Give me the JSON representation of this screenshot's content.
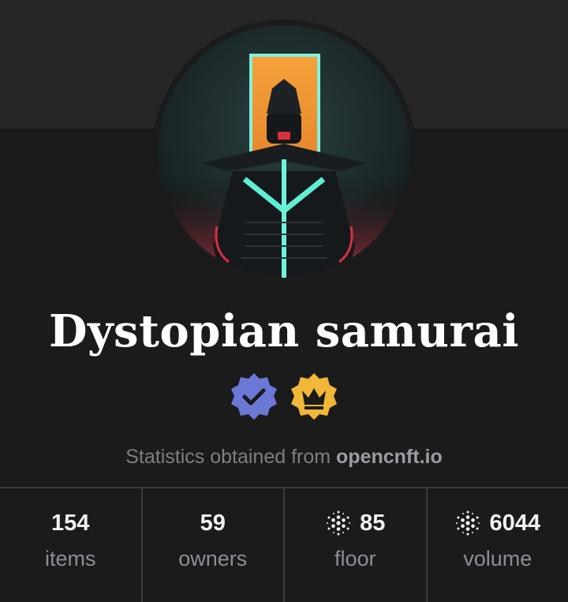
{
  "collection": {
    "name": "Dystopian samurai",
    "avatar_icon": "samurai-avatar",
    "badges": [
      {
        "icon": "verified-check-icon",
        "color": "#6b78d6"
      },
      {
        "icon": "crown-badge-icon",
        "color": "#f0b738"
      }
    ]
  },
  "source": {
    "prefix": "Statistics obtained from",
    "link": "opencnft.io"
  },
  "stats": [
    {
      "value": "154",
      "label": "items"
    },
    {
      "value": "59",
      "label": "owners"
    },
    {
      "value": "85",
      "label": "floor",
      "icon": "cardano-icon"
    },
    {
      "value": "6044",
      "label": "volume",
      "icon": "cardano-icon"
    }
  ]
}
